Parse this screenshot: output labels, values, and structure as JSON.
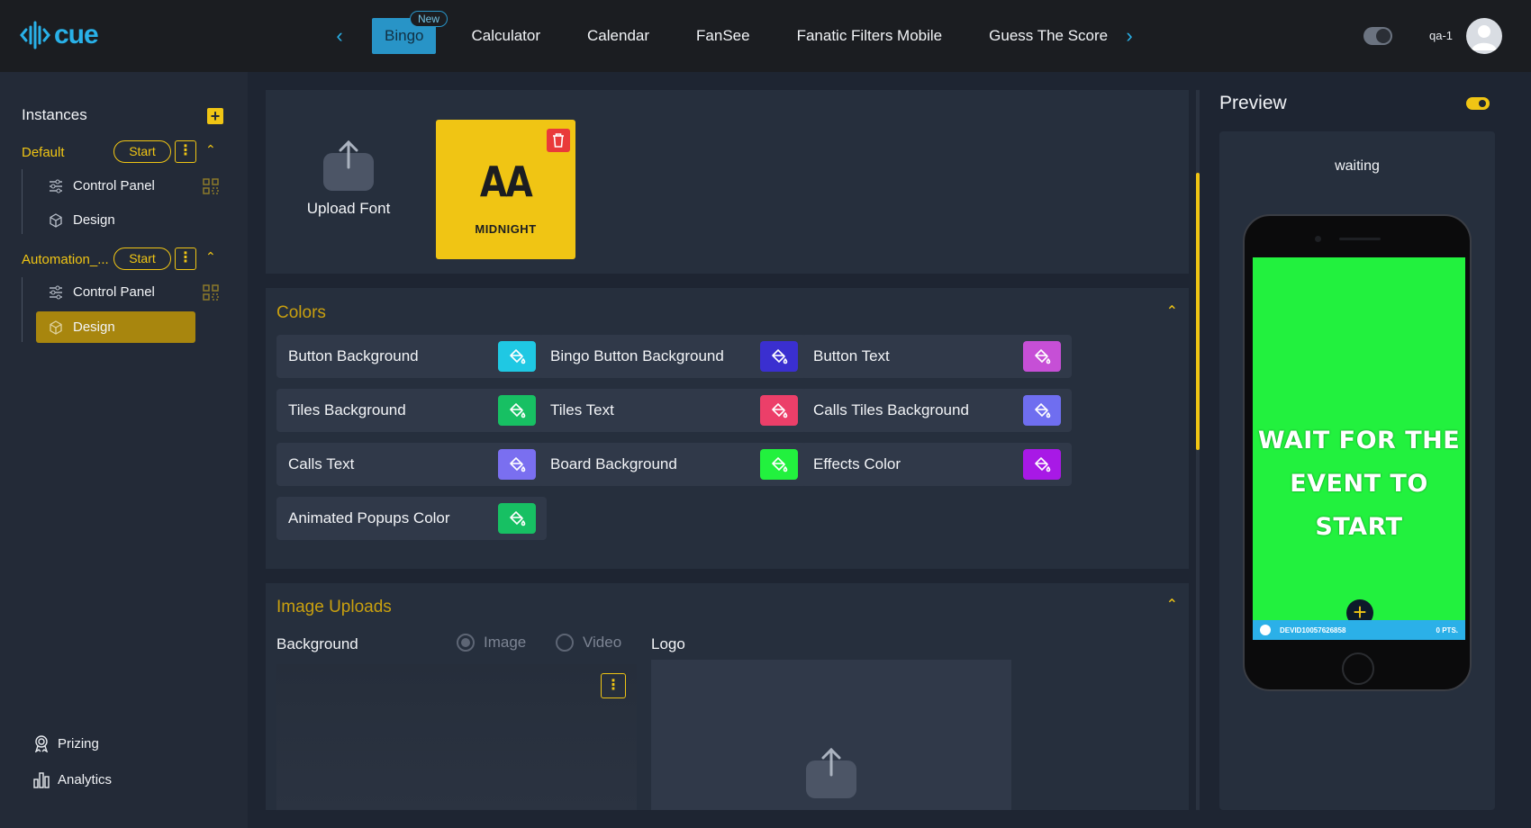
{
  "app": {
    "logo_text": "cue",
    "brand_color": "#29b1e8",
    "accent_color": "#f0c514"
  },
  "nav": {
    "tabs": [
      {
        "label": "Bingo",
        "badge": "New",
        "active": true
      },
      {
        "label": "Calculator"
      },
      {
        "label": "Calendar"
      },
      {
        "label": "FanSee"
      },
      {
        "label": "Fanatic Filters Mobile"
      },
      {
        "label": "Guess The Score"
      }
    ],
    "user_name": "qa-1"
  },
  "sidebar": {
    "title": "Instances",
    "instances": [
      {
        "name": "Default",
        "start_label": "Start",
        "items": [
          {
            "label": "Control Panel",
            "icon": "sliders-icon"
          },
          {
            "label": "Design",
            "icon": "cube-icon"
          }
        ]
      },
      {
        "name": "Automation_...",
        "start_label": "Start",
        "items": [
          {
            "label": "Control Panel",
            "icon": "sliders-icon"
          },
          {
            "label": "Design",
            "icon": "cube-icon",
            "active": true
          }
        ]
      }
    ],
    "bottom": [
      {
        "label": "Prizing",
        "icon": "award-icon"
      },
      {
        "label": "Analytics",
        "icon": "bar-chart-icon"
      }
    ]
  },
  "fonts": {
    "upload_label": "Upload Font",
    "selected": {
      "preview": "AA",
      "name": "MIDNIGHT"
    }
  },
  "colors": {
    "title": "Colors",
    "items": [
      {
        "label": "Button Background",
        "color": "#1fc8e3"
      },
      {
        "label": "Bingo Button Background",
        "color": "#3a2fd0"
      },
      {
        "label": "Button Text",
        "color": "#c64fd6"
      },
      {
        "label": "Tiles Background",
        "color": "#17c063"
      },
      {
        "label": "Tiles Text",
        "color": "#ec3f69"
      },
      {
        "label": "Calls Tiles Background",
        "color": "#6f6ef0"
      },
      {
        "label": "Calls Text",
        "color": "#7a6ff0"
      },
      {
        "label": "Board Background",
        "color": "#22f13e"
      },
      {
        "label": "Effects Color",
        "color": "#a819e6"
      },
      {
        "label": "Animated Popups Color",
        "color": "#17c063"
      }
    ]
  },
  "uploads": {
    "title": "Image Uploads",
    "background_label": "Background",
    "radio_image": "Image",
    "radio_video": "Video",
    "logo_label": "Logo"
  },
  "preview": {
    "title": "Preview",
    "status": "waiting",
    "screen_line1": "Wait for the",
    "screen_line2": "event to start",
    "device_id": "DEVID10057626858",
    "points": "0 PTS.",
    "screen_color": "#22f13e"
  }
}
